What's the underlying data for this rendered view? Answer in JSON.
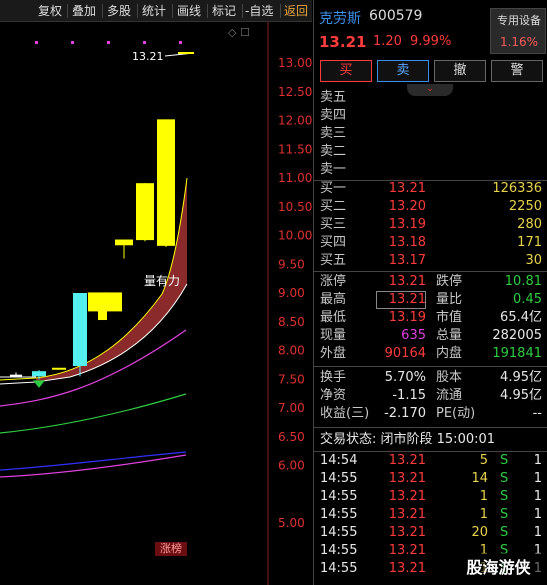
{
  "toolbar": {
    "items": [
      "复权",
      "叠加",
      "多股",
      "统计",
      "画线",
      "标记",
      "-自选",
      "返回"
    ]
  },
  "chart": {
    "y_ticks": [
      "13.00",
      "12.50",
      "12.00",
      "11.50",
      "11.00",
      "10.50",
      "10.00",
      "9.50",
      "9.00",
      "8.50",
      "8.00",
      "7.50",
      "7.00",
      "6.50",
      "6.00",
      "5.00"
    ],
    "high_label": "13.21",
    "strong_label": "量有力",
    "limit_badge": "涨榜"
  },
  "quote": {
    "name": "克劳斯",
    "code": "600579",
    "price": "13.21",
    "change": "1.20",
    "change_pct": "9.99%",
    "device_label": "专用设备",
    "device_pct": "1.16%"
  },
  "actions": {
    "buy": "买",
    "sell": "卖",
    "cancel": "撤",
    "alert": "警"
  },
  "asks": [
    {
      "label": "卖五",
      "price": "",
      "vol": ""
    },
    {
      "label": "卖四",
      "price": "",
      "vol": ""
    },
    {
      "label": "卖三",
      "price": "",
      "vol": ""
    },
    {
      "label": "卖二",
      "price": "",
      "vol": ""
    },
    {
      "label": "卖一",
      "price": "",
      "vol": ""
    }
  ],
  "bids": [
    {
      "label": "买一",
      "price": "13.21",
      "vol": "126336"
    },
    {
      "label": "买二",
      "price": "13.20",
      "vol": "2250"
    },
    {
      "label": "买三",
      "price": "13.19",
      "vol": "280"
    },
    {
      "label": "买四",
      "price": "13.18",
      "vol": "171"
    },
    {
      "label": "买五",
      "price": "13.17",
      "vol": "30"
    }
  ],
  "stats": [
    {
      "l1": "涨停",
      "v1": "13.21",
      "l2": "跌停",
      "v2": "10.81"
    },
    {
      "l1": "最高",
      "v1": "13.21",
      "l2": "量比",
      "v2": "0.45"
    },
    {
      "l1": "最低",
      "v1": "13.19",
      "l2": "市值",
      "v2": "65.4亿"
    },
    {
      "l1": "现量",
      "v1": "635",
      "l2": "总量",
      "v2": "282005"
    },
    {
      "l1": "外盘",
      "v1": "90164",
      "l2": "内盘",
      "v2": "191841"
    }
  ],
  "stats2": [
    {
      "l1": "换手",
      "v1": "5.70%",
      "l2": "股本",
      "v2": "4.95亿"
    },
    {
      "l1": "净资",
      "v1": "-1.15",
      "l2": "流通",
      "v2": "4.95亿"
    },
    {
      "l1": "收益(三)",
      "v1": "-2.170",
      "l2": "PE(动)",
      "v2": "--"
    }
  ],
  "status": "交易状态: 闭市阶段 15:00:01",
  "ticks": [
    {
      "time": "14:54",
      "price": "13.21",
      "vol": "5",
      "side": "S",
      "n": "1"
    },
    {
      "time": "14:55",
      "price": "13.21",
      "vol": "14",
      "side": "S",
      "n": "1"
    },
    {
      "time": "14:55",
      "price": "13.21",
      "vol": "1",
      "side": "S",
      "n": "1"
    },
    {
      "time": "14:55",
      "price": "13.21",
      "vol": "1",
      "side": "S",
      "n": "1"
    },
    {
      "time": "14:55",
      "price": "13.21",
      "vol": "20",
      "side": "S",
      "n": "1"
    },
    {
      "time": "14:55",
      "price": "13.21",
      "vol": "1",
      "side": "S",
      "n": "1"
    },
    {
      "time": "14:55",
      "price": "13.21",
      "vol": "1",
      "side": "S",
      "n": "1"
    }
  ],
  "watermark": "股海游侠",
  "colors": {
    "up": "#ff3b3b",
    "down": "#2ecc40",
    "accent": "#3a8ee6",
    "candle_up": "#ffff00",
    "candle_cyan": "#54f0f0",
    "band_fill": "#8b2a2a"
  }
}
